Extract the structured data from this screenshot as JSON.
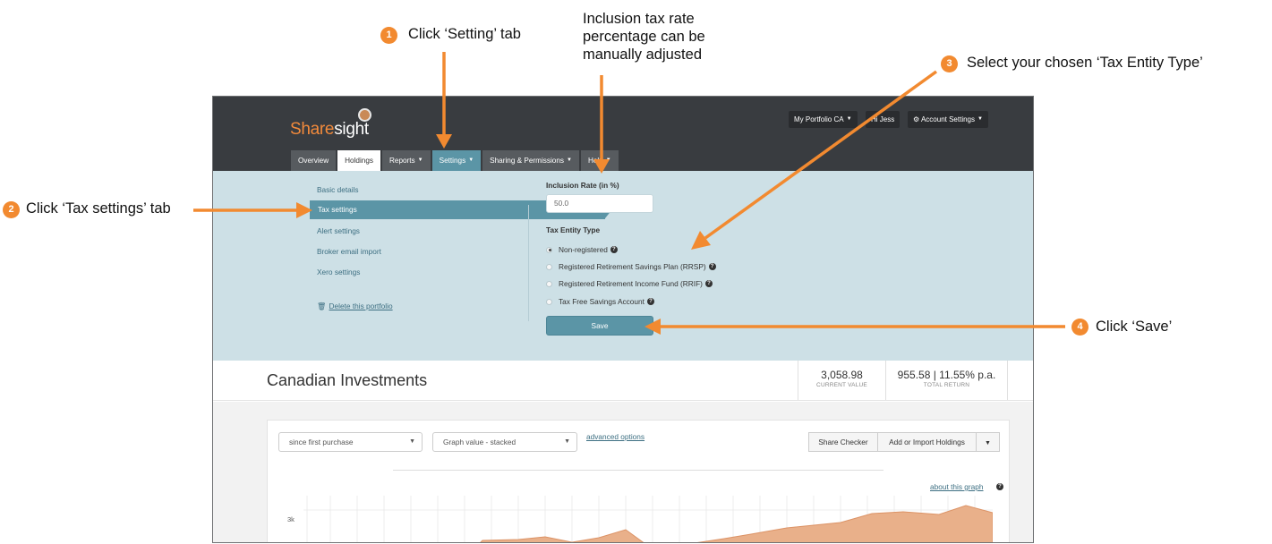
{
  "annotations": {
    "step1": {
      "number": "1",
      "text": "Click ‘Setting’ tab"
    },
    "step2": {
      "number": "2",
      "text": "Click ‘Tax settings’ tab"
    },
    "step3": {
      "number": "3",
      "text": "Select your chosen ‘Tax Entity Type’"
    },
    "step4": {
      "number": "4",
      "text": "Click ‘Save’"
    },
    "note_lines": [
      "Inclusion tax rate",
      "percentage can be",
      "manually adjusted"
    ],
    "arrow_color": "#f28a30"
  },
  "app": {
    "logo": {
      "part1": "Share",
      "part2": "sight"
    },
    "top_buttons": {
      "portfolio": "My Portfolio CA",
      "greeting": "Hi Jess",
      "account": "Account Settings"
    },
    "tabs": [
      "Overview",
      "Holdings",
      "Reports",
      "Settings",
      "Sharing & Permissions",
      "Help"
    ],
    "settings_menu": {
      "items": [
        "Basic details",
        "Tax settings",
        "Alert settings",
        "Broker email import",
        "Xero settings"
      ],
      "active": "Tax settings",
      "delete_link": "Delete this portfolio"
    },
    "tax_form": {
      "rate_label": "Inclusion Rate (in %)",
      "rate_value": "50.0",
      "entity_label": "Tax Entity Type",
      "options": [
        {
          "label": "Non-registered",
          "checked": true
        },
        {
          "label": "Registered Retirement Savings Plan (RRSP)",
          "checked": false
        },
        {
          "label": "Registered Retirement Income Fund (RRIF)",
          "checked": false
        },
        {
          "label": "Tax Free Savings Account",
          "checked": false
        }
      ],
      "save_label": "Save"
    },
    "portfolio": {
      "title": "Canadian Investments",
      "current_value": "3,058.98",
      "current_value_label": "CURRENT VALUE",
      "total_return": "955.58 | 11.55% p.a.",
      "total_return_label": "TOTAL RETURN"
    },
    "controls": {
      "period_select": "since first purchase",
      "graph_select": "Graph value - stacked",
      "advanced": "advanced options",
      "share_checker": "Share Checker",
      "add_import": "Add or Import Holdings",
      "about_graph": "about this graph",
      "y_tick": "3k"
    },
    "colors": {
      "accent": "#5b95a6",
      "brand_orange": "#f28a3b",
      "panel": "#cde0e6",
      "chart_fill": "#e9b08a"
    }
  }
}
